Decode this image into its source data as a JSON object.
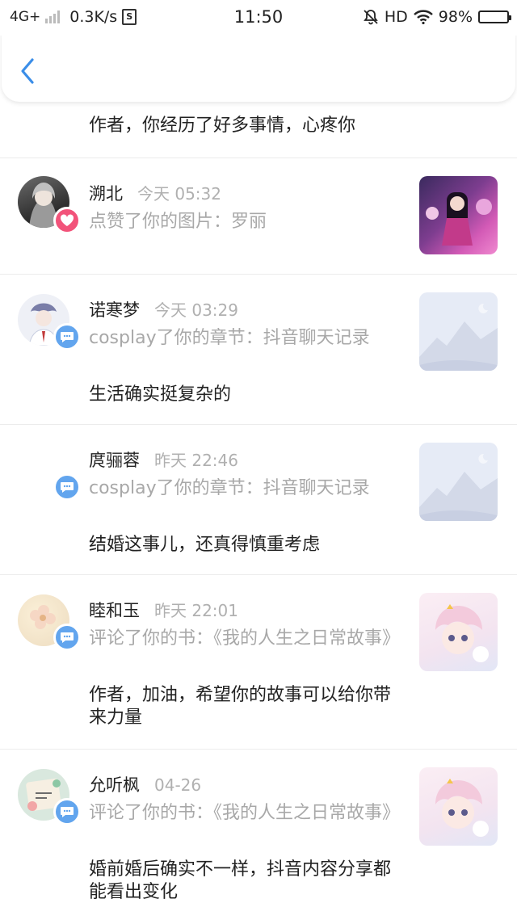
{
  "status_bar": {
    "network": "4G+",
    "speed": "0.3K/s",
    "time": "11:50",
    "hd": "HD",
    "battery": "98%",
    "battery_level": 0.98
  },
  "header": {
    "back_icon": "chevron-left-icon"
  },
  "first_item": {
    "comment": "作者，你经历了好多事情，心疼你"
  },
  "notifications": [
    {
      "name": "溯北",
      "time": "今天 05:32",
      "action": "点赞了你的图片：罗丽",
      "comment": "",
      "badge": "heart-icon"
    },
    {
      "name": "诺寒梦",
      "time": "今天 03:29",
      "action": "cosplay了你的章节：抖音聊天记录",
      "comment": "生活确实挺复杂的",
      "badge": "chat-icon"
    },
    {
      "name": "庹骊蓉",
      "time": "昨天 22:46",
      "action": "cosplay了你的章节：抖音聊天记录",
      "comment": "结婚这事儿，还真得慎重考虑",
      "badge": "chat-icon"
    },
    {
      "name": "睦和玉",
      "time": "昨天 22:01",
      "action": "评论了你的书：《我的人生之日常故事》",
      "comment": "作者，加油，希望你的故事可以给你带来力量",
      "badge": "chat-icon"
    },
    {
      "name": "允听枫",
      "time": "04-26",
      "action": "评论了你的书：《我的人生之日常故事》",
      "comment": "婚前婚后确实不一样，抖音内容分享都能看出变化",
      "badge": "chat-icon"
    }
  ],
  "colors": {
    "accent": "#3b8ee8",
    "heart_badge": "#f2537a",
    "chat_badge": "#62a5ee",
    "muted_text": "#a8a8a8"
  }
}
